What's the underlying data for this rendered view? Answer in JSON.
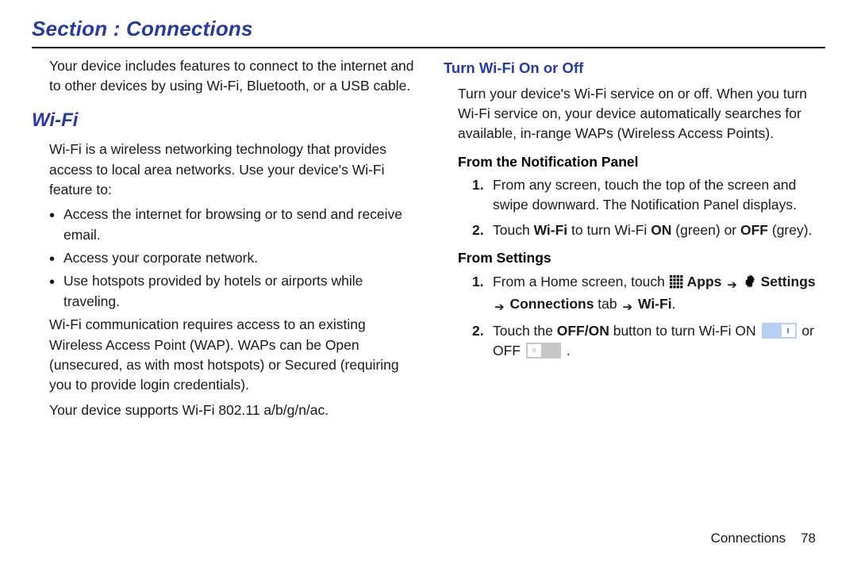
{
  "section_title": "Section : Connections",
  "left": {
    "intro": "Your device includes features to connect to the internet and to other devices by using Wi-Fi, Bluetooth, or a USB cable.",
    "h_wifi": "Wi-Fi",
    "wifi_intro": "Wi-Fi is a wireless networking technology that provides access to local area networks. Use your device's Wi-Fi feature to:",
    "bullets": [
      "Access the internet for browsing or to send and receive email.",
      "Access your corporate network.",
      "Use hotspots provided by hotels or airports while traveling."
    ],
    "wap_para": "Wi-Fi communication requires access to an existing Wireless Access Point (WAP). WAPs can be Open (unsecured, as with most hotspots) or Secured (requiring you to provide login credentials).",
    "support_para": "Your device supports Wi-Fi 802.11 a/b/g/n/ac."
  },
  "right": {
    "h_turn": "Turn Wi-Fi On or Off",
    "turn_intro": "Turn your device's Wi-Fi service on or off. When you turn Wi-Fi service on, your device automatically searches for available, in-range WAPs (Wireless Access Points).",
    "h_notif": "From the Notification Panel",
    "notif_steps": {
      "n1": "1.",
      "s1": "From any screen, touch the top of the screen and swipe downward. The Notification Panel displays.",
      "n2": "2.",
      "s2a": "Touch ",
      "s2b": "Wi-Fi",
      "s2c": " to turn Wi-Fi ",
      "s2d": "ON",
      "s2e": " (green) or ",
      "s2f": "OFF",
      "s2g": " (grey)."
    },
    "h_settings": "From Settings",
    "set_steps": {
      "n1": "1.",
      "s1a": "From a Home screen, touch ",
      "s1_apps": "Apps",
      "s1_settings": "Settings",
      "s1_conn": "Connections",
      "s1_tab": " tab ",
      "s1_wifi": "Wi-Fi",
      "s1_period": ".",
      "n2": "2.",
      "s2a": "Touch the ",
      "s2b": "OFF/ON",
      "s2c": " button to turn Wi-Fi ON ",
      "s2d": " or OFF ",
      "s2e": "."
    }
  },
  "footer": {
    "label": "Connections",
    "page": "78"
  }
}
